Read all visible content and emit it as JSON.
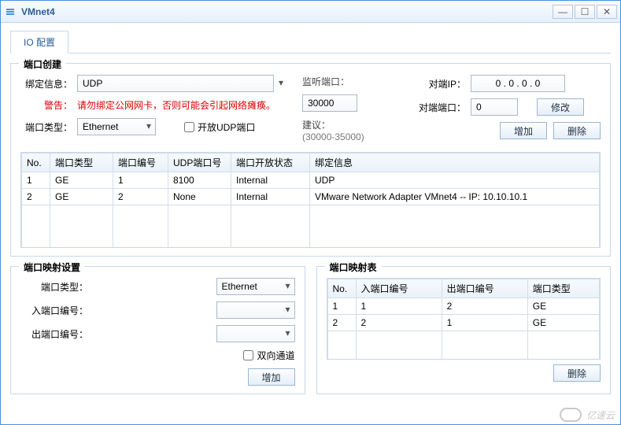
{
  "window": {
    "title": "VMnet4",
    "min": "—",
    "max": "☐",
    "close": "✕"
  },
  "tab": {
    "io": "IO 配置"
  },
  "portCreate": {
    "legend": "端口创建",
    "bindLabel": "绑定信息：",
    "bindValue": "UDP",
    "warnLabel": "警告：",
    "warnText": "请勿绑定公网网卡，否则可能会引起网络瘫痪。",
    "typeLabel": "端口类型：",
    "typeValue": "Ethernet",
    "openUdp": "开放UDP端口",
    "listenLabel": "监听端口：",
    "listenValue": "30000",
    "suggestLabel": "建议：",
    "suggestRange": "(30000-35000)",
    "peerIpLabel": "对端IP：",
    "peerIpValue": "0 . 0 . 0 . 0",
    "peerPortLabel": "对端端口：",
    "peerPortValue": "0",
    "modifyBtn": "修改",
    "addBtn": "增加",
    "delBtn": "删除",
    "cols": {
      "no": "No.",
      "type": "端口类型",
      "num": "端口编号",
      "udp": "UDP端口号",
      "open": "端口开放状态",
      "bind": "绑定信息"
    },
    "rows": [
      {
        "no": "1",
        "type": "GE",
        "num": "1",
        "udp": "8100",
        "open": "Internal",
        "bind": "UDP"
      },
      {
        "no": "2",
        "type": "GE",
        "num": "2",
        "udp": "None",
        "open": "Internal",
        "bind": "VMware Network Adapter VMnet4 -- IP: 10.10.10.1"
      }
    ]
  },
  "mapSet": {
    "legend": "端口映射设置",
    "typeLabel": "端口类型：",
    "typeValue": "Ethernet",
    "inLabel": "入端口编号：",
    "inValue": "",
    "outLabel": "出端口编号：",
    "outValue": "",
    "biDir": "双向通道",
    "addBtn": "增加"
  },
  "mapTbl": {
    "legend": "端口映射表",
    "cols": {
      "no": "No.",
      "in": "入端口编号",
      "out": "出端口编号",
      "type": "端口类型"
    },
    "rows": [
      {
        "no": "1",
        "in": "1",
        "out": "2",
        "type": "GE"
      },
      {
        "no": "2",
        "in": "2",
        "out": "1",
        "type": "GE"
      }
    ],
    "delBtn": "删除"
  },
  "watermark": "亿速云"
}
